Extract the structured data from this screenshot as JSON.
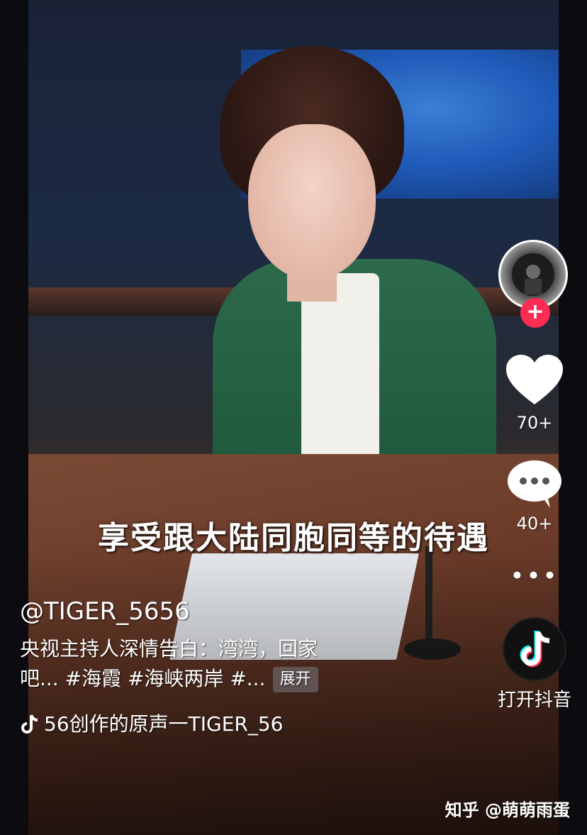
{
  "subtitle": "享受跟大陆同胞同等的待遇",
  "sidebar": {
    "follow_symbol": "+",
    "likes_count": "70+",
    "comments_count": "40+",
    "more_symbol": "•••",
    "open_app_label": "打开抖音"
  },
  "post": {
    "username": "@TIGER_5656",
    "description_line1": "央视主持人深情告白：湾湾，回家",
    "description_line2": "吧... #海霞 #海峡两岸 #...",
    "expand_label": "展开",
    "music_text": "56创作的原声一TIGER_56"
  },
  "watermark": "知乎 @萌萌雨蛋",
  "colors": {
    "accent": "#fe2c55",
    "jacket": "#1f5a3d"
  },
  "icons": {
    "like": "heart-icon",
    "comment": "comment-icon",
    "more": "more-icon",
    "app": "tiktok-logo-icon",
    "music": "music-note-icon"
  }
}
